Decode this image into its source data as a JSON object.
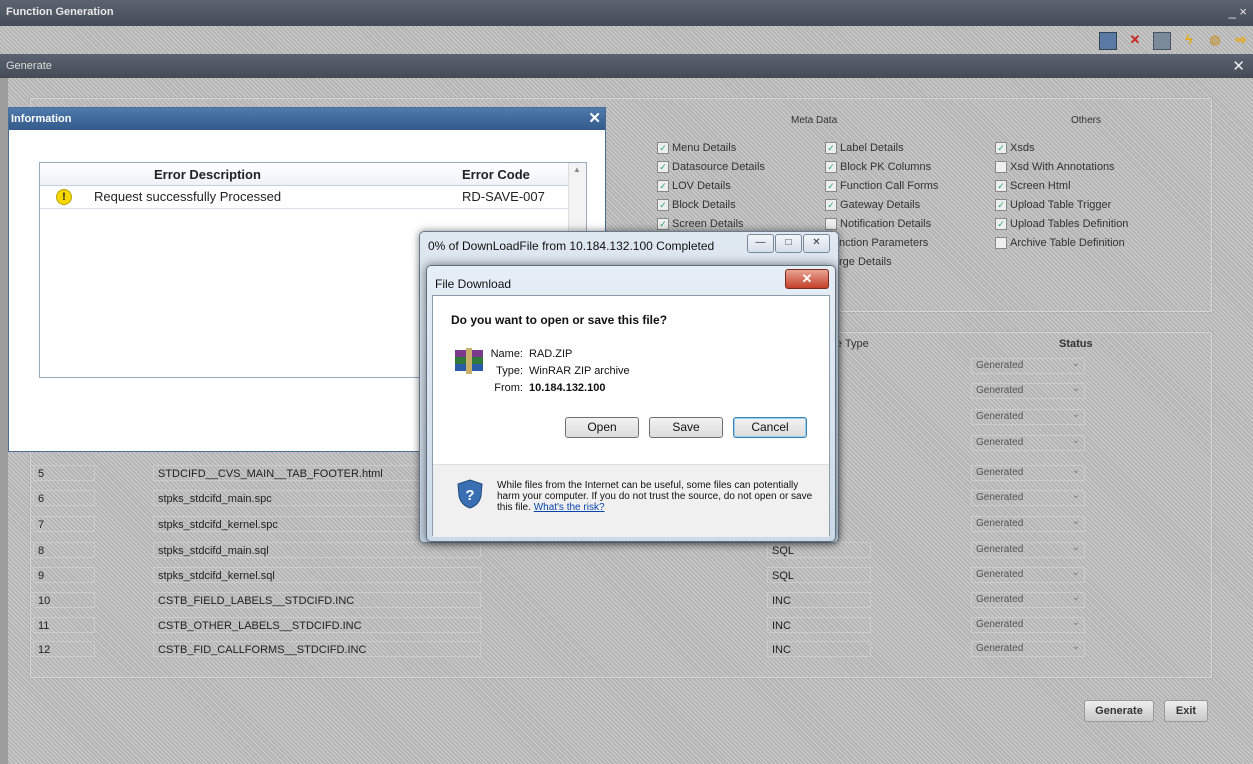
{
  "app": {
    "title": "Function Generation",
    "window_controls": "_ ×",
    "toolbar_icons": [
      "save-icon",
      "delete-icon",
      "calculator-icon",
      "function-icon",
      "copy-icon",
      "exit-icon"
    ]
  },
  "generate_window": {
    "title": "Generate",
    "close": "✕"
  },
  "meta_data": {
    "title": "Meta Data",
    "col1": [
      "Menu Details",
      "Datasource Details",
      "LOV Details",
      "Block Details",
      "Screen Details"
    ],
    "col2": [
      "Label Details",
      "Block PK Columns",
      "Function Call Forms",
      "Gateway Details",
      "Notification Details",
      "Function Parameters",
      "Purge Details"
    ],
    "col2_visible": [
      "Label Details",
      "Block PK Columns",
      "Function Call Forms",
      "Gateway Details",
      "Notification Details",
      "nction Parameters",
      "rge Details"
    ],
    "col2_checked": [
      true,
      true,
      true,
      true,
      false,
      false,
      false
    ]
  },
  "others": {
    "title": "Others",
    "items": [
      "Xsds",
      "Xsd With Annotations",
      "Screen Html",
      "Upload Table Trigger",
      "Upload Tables Definition",
      "Archive Table Definition"
    ],
    "checked": [
      true,
      false,
      true,
      true,
      true,
      false
    ]
  },
  "files_table": {
    "file_type_header": "ile Type",
    "status_header": "Status",
    "rows": [
      {
        "no": "5",
        "name": "STDCIFD__CVS_MAIN__TAB_FOOTER.html",
        "type": "",
        "status": "Generated"
      },
      {
        "no": "6",
        "name": "stpks_stdcifd_main.spc",
        "type": "",
        "status": "Generated"
      },
      {
        "no": "7",
        "name": "stpks_stdcifd_kernel.spc",
        "type": "",
        "status": "Generated"
      },
      {
        "no": "8",
        "name": "stpks_stdcifd_main.sql",
        "type": "SQL",
        "status": "Generated"
      },
      {
        "no": "9",
        "name": "stpks_stdcifd_kernel.sql",
        "type": "SQL",
        "status": "Generated"
      },
      {
        "no": "10",
        "name": "CSTB_FIELD_LABELS__STDCIFD.INC",
        "type": "INC",
        "status": "Generated"
      },
      {
        "no": "11",
        "name": "CSTB_OTHER_LABELS__STDCIFD.INC",
        "type": "INC",
        "status": "Generated"
      },
      {
        "no": "12",
        "name": "CSTB_FID_CALLFORMS__STDCIFD.INC",
        "type": "INC",
        "status": "Generated"
      }
    ],
    "upper_status": [
      "Generated",
      "Generated",
      "Generated",
      "Generated"
    ]
  },
  "buttons": {
    "generate": "Generate",
    "exit": "Exit"
  },
  "info_dialog": {
    "title": "Information",
    "close": "✕",
    "col_desc": "Error Description",
    "col_code": "Error Code",
    "row_desc": "Request successfully Processed",
    "row_code": "RD-SAVE-007",
    "row_icon": "!"
  },
  "progress_window": {
    "title": "0% of DownLoadFile from 10.184.132.100 Completed",
    "controls": [
      "—",
      "□",
      "✕"
    ]
  },
  "file_download": {
    "title": "File Download",
    "close": "✕",
    "question": "Do you want to open or save this file?",
    "name_label": "Name:",
    "name_value": "RAD.ZIP",
    "type_label": "Type:",
    "type_value": "WinRAR ZIP archive",
    "from_label": "From:",
    "from_value": "10.184.132.100",
    "open": "Open",
    "save": "Save",
    "cancel": "Cancel",
    "warning": "While files from the Internet can be useful, some files can potentially harm your computer. If you do not trust the source, do not open or save this file.",
    "risk_link": "What's the risk?"
  }
}
